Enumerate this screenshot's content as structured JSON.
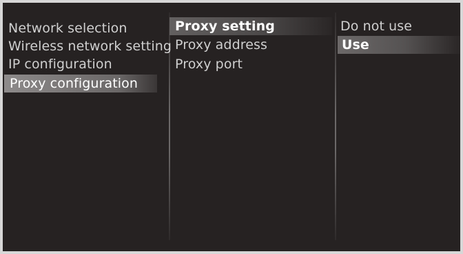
{
  "menu": {
    "level1": [
      {
        "label": "Network selection"
      },
      {
        "label": "Wireless network setting"
      },
      {
        "label": "IP configuration"
      },
      {
        "label": "Proxy configuration"
      }
    ],
    "level2": [
      {
        "label": "Proxy setting"
      },
      {
        "label": "Proxy address"
      },
      {
        "label": "Proxy port"
      }
    ],
    "level3": [
      {
        "label": "Do not use"
      },
      {
        "label": "Use"
      }
    ]
  }
}
